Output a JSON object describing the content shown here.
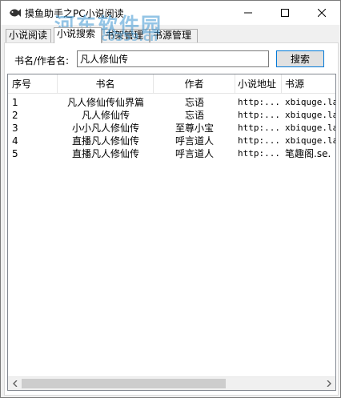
{
  "window": {
    "title": "摸鱼助手之PC小说阅读",
    "watermark": "河东软件园",
    "watermark_url": "www.pc0359.cn"
  },
  "tabs": [
    {
      "label": "小说阅读",
      "active": false
    },
    {
      "label": "小说搜索",
      "active": true
    },
    {
      "label": "书架管理",
      "active": false
    },
    {
      "label": "书源管理",
      "active": false
    }
  ],
  "search": {
    "label": "书名/作者名:",
    "value": "凡人修仙传",
    "button_label": "搜索"
  },
  "table": {
    "headers": [
      "序号",
      "书名",
      "作者",
      "小说地址",
      "书源"
    ],
    "rows": [
      {
        "id": "1",
        "title": "凡人修仙传仙界篇",
        "author": "忘语",
        "url": "http:...",
        "source": "xbiquge.la"
      },
      {
        "id": "2",
        "title": "凡人修仙传",
        "author": "忘语",
        "url": "http:...",
        "source": "xbiquge.la"
      },
      {
        "id": "3",
        "title": "小小凡人修仙传",
        "author": "至尊小宝",
        "url": "http:...",
        "source": "xbiquge.la"
      },
      {
        "id": "4",
        "title": "直播凡人修仙传",
        "author": "呼言道人",
        "url": "http:...",
        "source": "xbiquge.la"
      },
      {
        "id": "5",
        "title": "直播凡人修仙传",
        "author": "呼言道人",
        "url": "http:...",
        "source": "笔趣阁.se."
      }
    ]
  },
  "colors": {
    "accent": "#0078d7",
    "watermark": "#3c96d2"
  }
}
